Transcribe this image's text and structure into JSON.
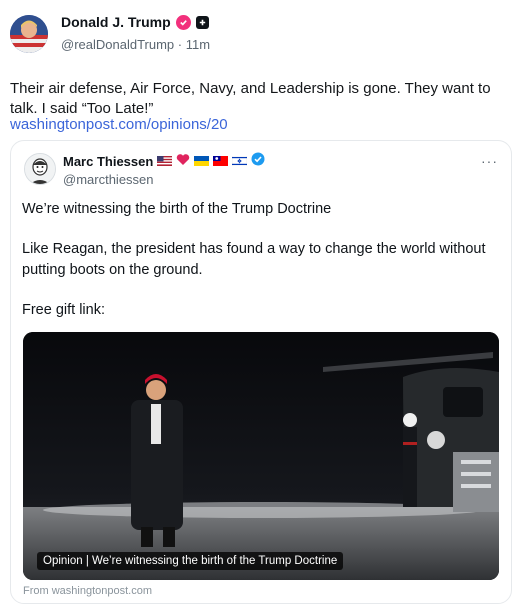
{
  "post": {
    "author_name": "Donald J. Trump",
    "handle": "@realDonaldTrump",
    "separator": "·",
    "time": "11m",
    "text": "Their air defense, Air Force, Navy, and Leadership is gone. They want to talk. I said “Too Late!”",
    "link": "washingtonpost.com/opinions/20"
  },
  "quote": {
    "author_name": "Marc Thiessen",
    "handle": "@marcthiessen",
    "more": "···",
    "line1": "We’re witnessing the birth of the Trump Doctrine",
    "para2": "Like Reagan, the president has found a way to change the world without putting boots on the ground.",
    "para3": "Free gift link:",
    "image_caption": "Opinion | We’re witnessing the birth of the Trump Doctrine",
    "from": "From washingtonpost.com"
  },
  "colors": {
    "link": "#3b65d9",
    "verified_pink": "#f2307c",
    "verified_blue": "#1d9bf0"
  },
  "icons": [
    "verified-badge-icon",
    "square-badge-icon",
    "more-icon",
    "us-flag-icon",
    "heart-icon",
    "ukraine-flag-icon",
    "taiwan-flag-icon",
    "israel-flag-icon"
  ]
}
